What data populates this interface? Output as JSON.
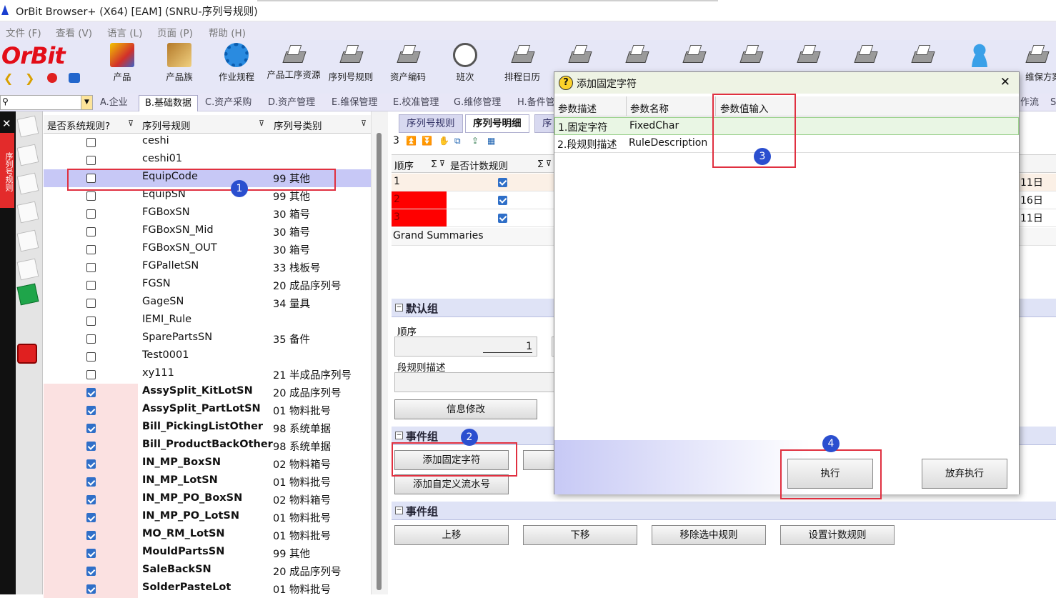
{
  "window": {
    "title": "OrBit Browser+ (X64) [EAM] (SNRU-序列号规则)"
  },
  "menu": [
    "文件 (F)",
    "查看 (V)",
    "语言 (L)",
    "页面 (P)",
    "帮助 (H)"
  ],
  "logo": "OrBit",
  "toolbar": [
    "产品",
    "产品族",
    "作业规程",
    "产品工序资源",
    "序列号规则",
    "资产编码",
    "班次",
    "排程日历",
    "",
    "",
    "",
    "",
    "",
    "",
    "",
    "",
    "维保方案"
  ],
  "module_tabs": [
    "A.企业",
    "B.基础数据",
    "C.资产采购",
    "D.资产管理",
    "E.维保管理",
    "E.校准管理",
    "G.维修管理",
    "H.备件管",
    "作流",
    "S"
  ],
  "sidebar": {
    "tab_label": "序列号规则"
  },
  "grid": {
    "headers": [
      "是否系统规则?",
      "序列号规则",
      "序列号类别"
    ],
    "rows": [
      {
        "sys": false,
        "name": "ceshi",
        "type": ""
      },
      {
        "sys": false,
        "name": "ceshi01",
        "type": ""
      },
      {
        "sys": false,
        "name": "EquipCode",
        "type": "99 其他"
      },
      {
        "sys": false,
        "name": "EquipSN",
        "type": "99 其他"
      },
      {
        "sys": false,
        "name": "FGBoxSN",
        "type": "30 箱号"
      },
      {
        "sys": false,
        "name": "FGBoxSN_Mid",
        "type": "30 箱号"
      },
      {
        "sys": false,
        "name": "FGBoxSN_OUT",
        "type": "30 箱号"
      },
      {
        "sys": false,
        "name": "FGPalletSN",
        "type": "33 栈板号"
      },
      {
        "sys": false,
        "name": "FGSN",
        "type": "20 成品序列号"
      },
      {
        "sys": false,
        "name": "GageSN",
        "type": "34 量具"
      },
      {
        "sys": false,
        "name": "IEMI_Rule",
        "type": ""
      },
      {
        "sys": false,
        "name": "SparePartsSN",
        "type": "35 备件"
      },
      {
        "sys": false,
        "name": "Test0001",
        "type": ""
      },
      {
        "sys": false,
        "name": "xy111",
        "type": "21 半成品序列号"
      },
      {
        "sys": true,
        "name": "AssySplit_KitLotSN",
        "type": "20 成品序列号"
      },
      {
        "sys": true,
        "name": "AssySplit_PartLotSN",
        "type": "01 物料批号"
      },
      {
        "sys": true,
        "name": "Bill_PickingListOther",
        "type": "98 系统单据"
      },
      {
        "sys": true,
        "name": "Bill_ProductBackOther",
        "type": "98 系统单据"
      },
      {
        "sys": true,
        "name": "IN_MP_BoxSN",
        "type": "02 物料箱号"
      },
      {
        "sys": true,
        "name": "IN_MP_LotSN",
        "type": "01 物料批号"
      },
      {
        "sys": true,
        "name": "IN_MP_PO_BoxSN",
        "type": "02 物料箱号"
      },
      {
        "sys": true,
        "name": "IN_MP_PO_LotSN",
        "type": "01 物料批号"
      },
      {
        "sys": true,
        "name": "MO_RM_LotSN",
        "type": "01 物料批号"
      },
      {
        "sys": true,
        "name": "MouldPartsSN",
        "type": "99 其他"
      },
      {
        "sys": true,
        "name": "SaleBackSN",
        "type": "20 成品序列号"
      },
      {
        "sys": true,
        "name": "SolderPasteLot",
        "type": "01 物料批号"
      }
    ]
  },
  "detail": {
    "subtabs": [
      "序列号规则",
      "序列号明细",
      "序"
    ],
    "count": "3",
    "headers": [
      "顺序",
      "是否计数规则"
    ],
    "rows": [
      {
        "no": "1",
        "date": "11日"
      },
      {
        "no": "2",
        "date": "16日"
      },
      {
        "no": "3",
        "date": "11日"
      }
    ],
    "summary": "Grand Summaries",
    "default_group": "默认组",
    "order_label": "顺序",
    "order_value": "1",
    "desc_label": "段规则描述",
    "edit_btn": "信息修改",
    "event_group": "事件组",
    "add_fixed_btn": "添加固定字符",
    "add_custom_btn": "添加自定义流水号",
    "event_group2": "事件组",
    "bottom_btns": [
      "上移",
      "下移",
      "移除选中规则",
      "设置计数规则"
    ]
  },
  "dialog": {
    "title": "添加固定字符",
    "headers": [
      "参数描述",
      "参数名称",
      "参数值输入"
    ],
    "rows": [
      {
        "desc": "1.固定字符",
        "name": "FixedChar",
        "value": ""
      },
      {
        "desc": "2.段规则描述",
        "name": "RuleDescription",
        "value": ""
      }
    ],
    "execute": "执行",
    "cancel": "放弃执行"
  },
  "badges": [
    "1",
    "2",
    "3",
    "4"
  ]
}
